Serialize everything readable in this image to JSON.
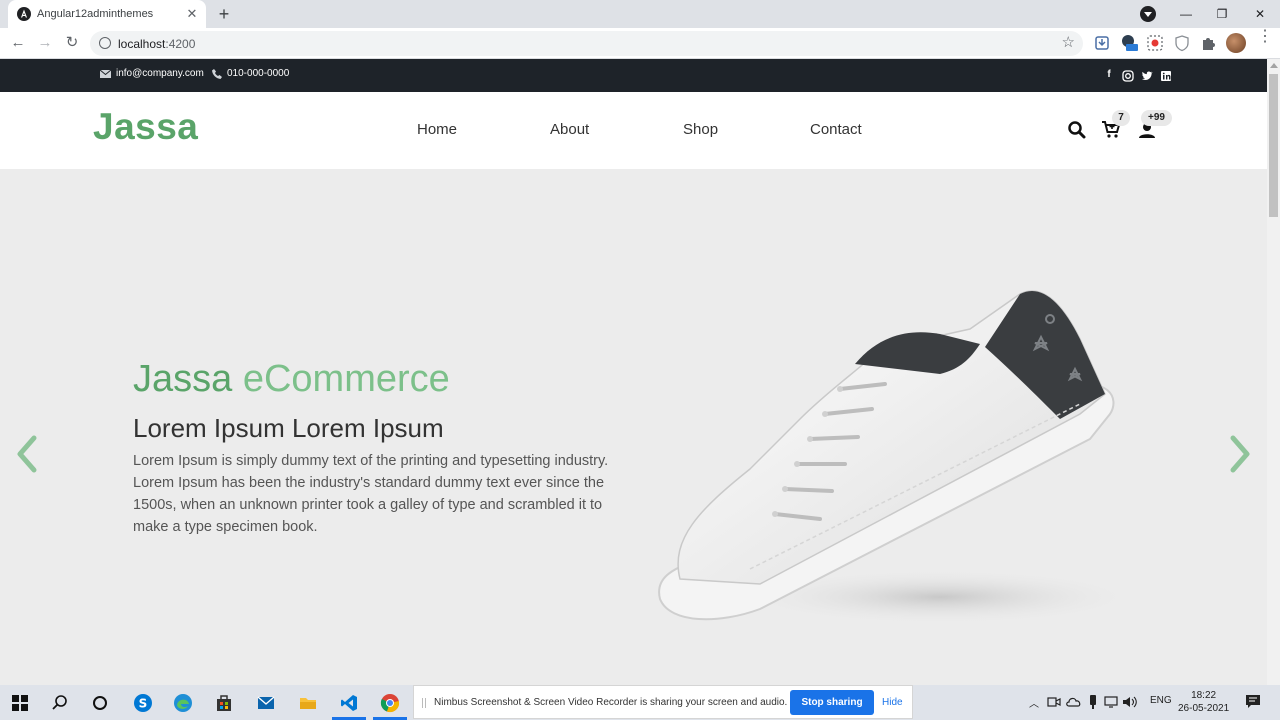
{
  "browser": {
    "tab_title": "Angular12adminthemes",
    "url_host": "localhost",
    "url_port": ":4200"
  },
  "topbar": {
    "email": "info@company.com",
    "phone": "010-000-0000",
    "social_icons": [
      "facebook-icon",
      "instagram-icon",
      "twitter-icon",
      "linkedin-icon"
    ]
  },
  "header": {
    "logo": "Jassa",
    "nav": [
      "Home",
      "About",
      "Shop",
      "Contact"
    ],
    "cart_count": "7",
    "user_count": "+99"
  },
  "hero": {
    "title_brand": "Jassa",
    "title_rest": "eCommerce",
    "subtitle": "Lorem Ipsum Lorem Ipsum",
    "text": "Lorem Ipsum is simply dummy text of the printing and typesetting industry. Lorem Ipsum has been the industry's standard dummy text ever since the 1500s, when an unknown printer took a galley of type and scrambled it to make a type specimen book."
  },
  "share_bar": {
    "message": "Nimbus Screenshot & Screen Video Recorder is sharing your screen and audio.",
    "stop_label": "Stop sharing",
    "hide_label": "Hide"
  },
  "taskbar": {
    "language": "ENG",
    "time": "18:22",
    "date": "26-05-2021"
  },
  "colors": {
    "brand_green": "#5aa469",
    "topbar_bg": "#1e2329",
    "hero_bg": "#ececec",
    "accent_blue": "#1a73e8"
  }
}
